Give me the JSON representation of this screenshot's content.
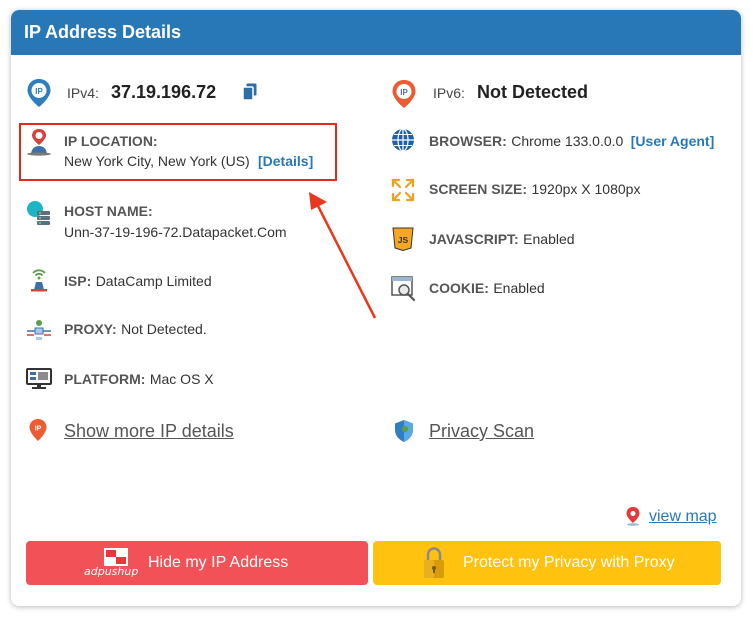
{
  "header": {
    "title": "IP Address Details"
  },
  "left": {
    "ipv4": {
      "label": "IPv4:",
      "value": "37.19.196.72",
      "icon": "ip-pin-icon",
      "copy_icon": "copy-icon"
    },
    "location": {
      "label": "IP LOCATION:",
      "value": "New York City, New York (US)",
      "link": "[Details]",
      "icon": "location-person-icon"
    },
    "host": {
      "label": "HOST NAME:",
      "value": "Unn-37-19-196-72.Datapacket.Com",
      "icon": "host-server-icon"
    },
    "isp": {
      "label": "ISP:",
      "value": "DataCamp Limited",
      "icon": "isp-tower-icon"
    },
    "proxy": {
      "label": "PROXY:",
      "value": "Not Detected.",
      "icon": "proxy-network-icon"
    },
    "platform": {
      "label": "PLATFORM:",
      "value": "Mac OS X",
      "icon": "monitor-icon"
    },
    "more_link": {
      "label": "Show more IP details",
      "icon": "ip-pin-icon"
    }
  },
  "right": {
    "ipv6": {
      "label": "IPv6:",
      "value": "Not Detected",
      "icon": "ip-pin-icon"
    },
    "browser": {
      "label": "BROWSER:",
      "value": "Chrome 133.0.0.0",
      "link": "[User Agent]",
      "icon": "globe-icon"
    },
    "screen": {
      "label": "SCREEN SIZE:",
      "value": "1920px X 1080px",
      "icon": "expand-arrows-icon"
    },
    "javascript": {
      "label": "JAVASCRIPT:",
      "value": "Enabled",
      "icon": "javascript-icon"
    },
    "cookie": {
      "label": "COOKIE:",
      "value": "Enabled",
      "icon": "cookie-search-icon"
    },
    "privacy_link": {
      "label": "Privacy Scan",
      "icon": "shield-icon"
    }
  },
  "view_map": {
    "label": "view map",
    "icon": "map-pin-icon"
  },
  "buttons": {
    "hide_ip": {
      "label": "Hide my IP Address",
      "brand": "adpushup"
    },
    "protect": {
      "label": "Protect my Privacy with Proxy",
      "icon": "padlock-icon"
    }
  },
  "colors": {
    "header": "#2878b8",
    "hide_button": "#f25157",
    "protect_button": "#ffc20e",
    "highlight": "#e02a1a",
    "arrow": "#e8391f"
  }
}
